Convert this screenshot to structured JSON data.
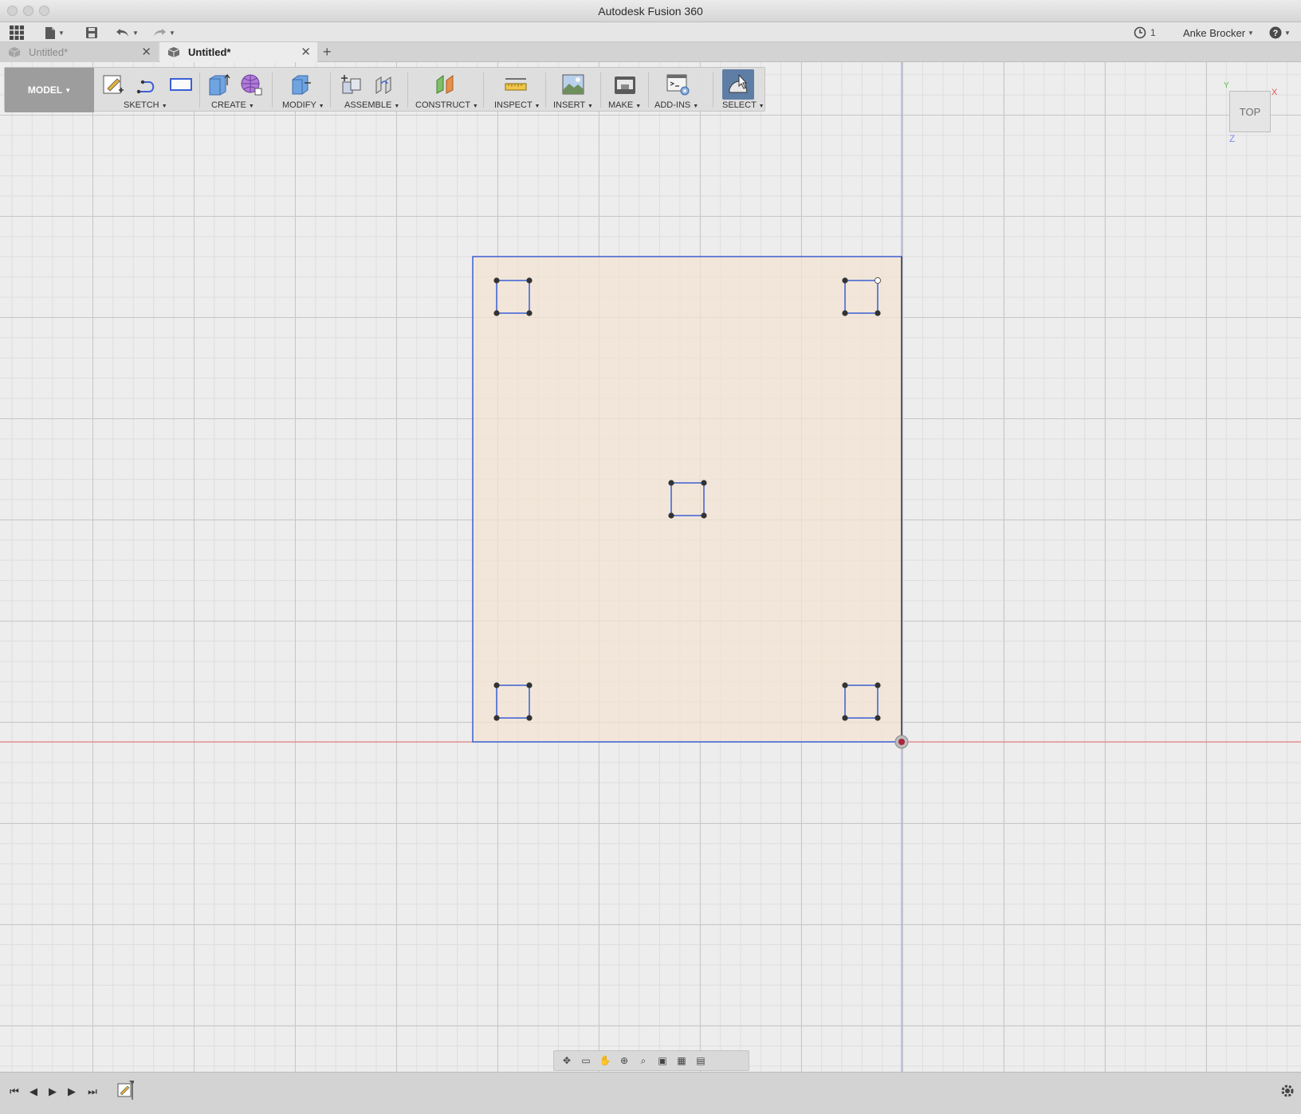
{
  "window": {
    "title": "Autodesk Fusion 360"
  },
  "quick_access": {
    "jobs_count": "1",
    "user_name": "Anke Brocker",
    "icons": [
      "grid-menu-icon",
      "file-icon",
      "save-icon",
      "undo-icon",
      "redo-icon",
      "clock-icon",
      "help-icon"
    ]
  },
  "tabs": [
    {
      "label": "Untitled*",
      "active": false
    },
    {
      "label": "Untitled*",
      "active": true
    }
  ],
  "ribbon": {
    "workspace": "MODEL",
    "groups": [
      "SKETCH",
      "CREATE",
      "MODIFY",
      "ASSEMBLE",
      "CONSTRUCT",
      "INSPECT",
      "INSERT",
      "MAKE",
      "ADD-INS",
      "SELECT"
    ]
  },
  "viewcube": {
    "face": "TOP",
    "axis_x": "X",
    "axis_y": "Y",
    "axis_z": "Z"
  },
  "colors": {
    "sketch_line": "#3b5fd6",
    "profile_fill": "#f2e3d2",
    "x_axis": "#e05555",
    "z_axis": "#7d8be8",
    "select_active": "#5e7ea6"
  }
}
